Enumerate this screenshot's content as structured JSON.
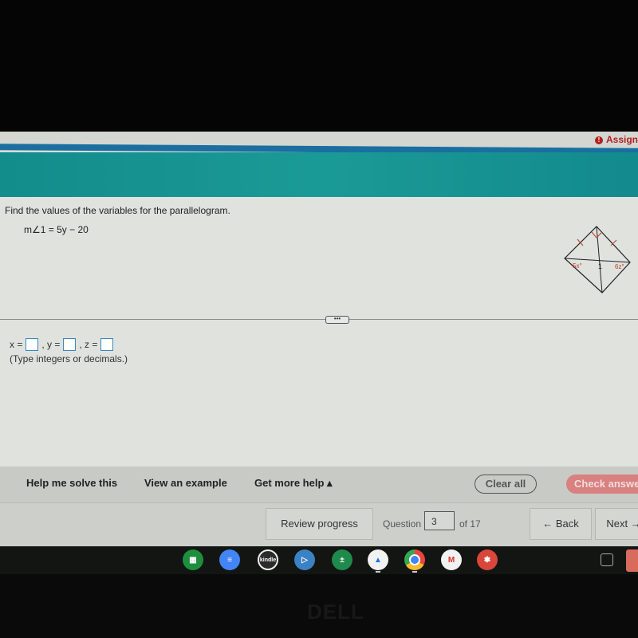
{
  "header": {
    "assignment_label": "Assign",
    "alert_icon": "exclamation-icon"
  },
  "problem": {
    "instruction": "Find the values of the variables for the parallelogram.",
    "given": "m∠1 = 5y − 20",
    "figure": {
      "shape": "rhombus",
      "labels": {
        "left_angle": "5x°",
        "center": "1",
        "right_angle": "6z°"
      },
      "marks": [
        "congruent-side tick marks on top sides",
        "right-angle marker at top vertex"
      ]
    }
  },
  "answer": {
    "x_label": "x =",
    "y_label": ", y =",
    "z_label": ", z =",
    "x_value": "",
    "y_value": "",
    "z_value": "",
    "hint": "(Type integers or decimals.)"
  },
  "divider_handle": "•••",
  "help": {
    "help_me_solve": "Help me solve this",
    "view_example": "View an example",
    "get_more_help": "Get more help ▴",
    "clear_all": "Clear all",
    "check_answer": "Check answer"
  },
  "nav": {
    "review_progress": "Review progress",
    "question_label": "Question",
    "question_number": "3",
    "of_total": "of 17",
    "back": "← Back",
    "next": "Next →"
  },
  "shelf": {
    "apps": [
      {
        "name": "Google Sheets",
        "icon": "sheets-icon",
        "color": "#1e8e3e"
      },
      {
        "name": "Google Docs",
        "icon": "docs-icon",
        "color": "#4285f4"
      },
      {
        "name": "Kindle",
        "icon": "kindle-icon",
        "color": "#2b2b2b"
      },
      {
        "name": "Screencastify",
        "icon": "play-icon",
        "color": "#3b82c4"
      },
      {
        "name": "Calculator",
        "icon": "calculator-icon",
        "color": "#1e8a4c"
      },
      {
        "name": "Google Drive",
        "icon": "drive-icon",
        "color": "#f2f2f2"
      },
      {
        "name": "Chrome",
        "icon": "chrome-icon",
        "color": "#e8453c"
      },
      {
        "name": "Gmail",
        "icon": "gmail-icon",
        "color": "#f2f2f2"
      },
      {
        "name": "Canvas",
        "icon": "palette-icon",
        "color": "#d9473a"
      }
    ]
  },
  "bezel": {
    "brand": "DELL"
  }
}
